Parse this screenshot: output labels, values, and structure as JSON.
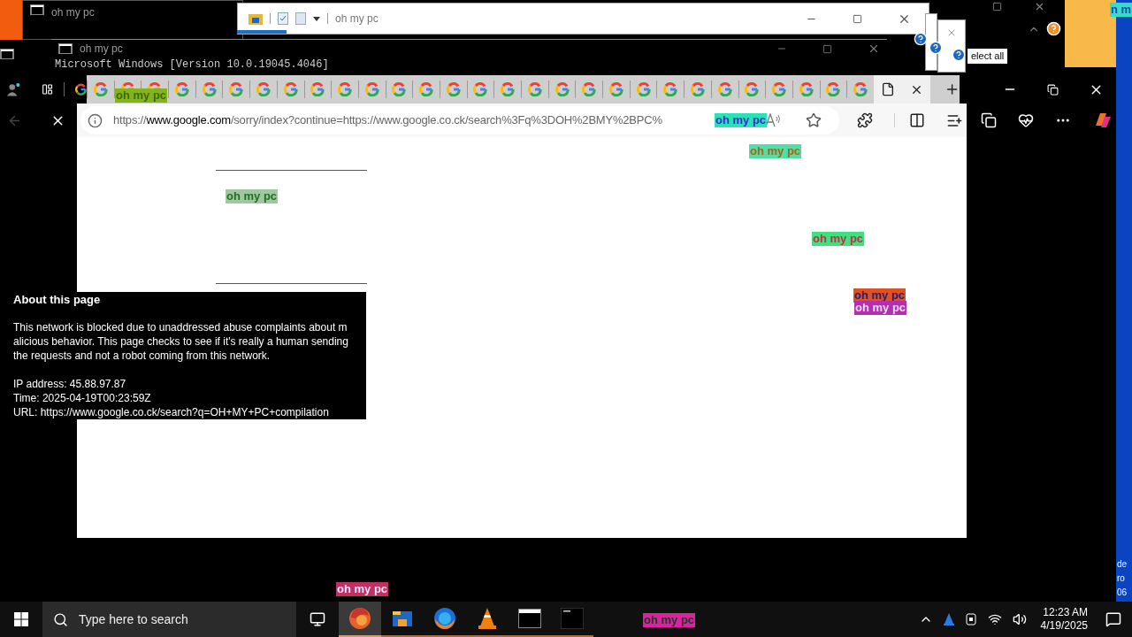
{
  "console_windows": [
    {
      "title": "oh my pc"
    },
    {
      "title": "oh my pc"
    }
  ],
  "console_text": "Microsoft Windows [Version 10.0.19045.4046]",
  "explorer_window": {
    "title": "oh my pc"
  },
  "dialog_text": "elect all",
  "browser": {
    "tabs": [
      {
        "selected": false
      },
      {
        "selected": false
      },
      {
        "selected": false
      },
      {
        "selected": false
      },
      {
        "selected": false
      },
      {
        "selected": false
      },
      {
        "selected": false
      },
      {
        "selected": false
      },
      {
        "selected": false
      },
      {
        "selected": false
      },
      {
        "selected": false
      },
      {
        "selected": false
      },
      {
        "selected": false
      },
      {
        "selected": false
      },
      {
        "selected": false
      },
      {
        "selected": false
      },
      {
        "selected": false
      },
      {
        "selected": false
      },
      {
        "selected": false
      },
      {
        "selected": false
      },
      {
        "selected": false
      },
      {
        "selected": false
      },
      {
        "selected": false
      },
      {
        "selected": false
      },
      {
        "selected": false
      },
      {
        "selected": false
      },
      {
        "selected": false
      },
      {
        "selected": false
      },
      {
        "selected": false
      },
      {
        "selected": true
      }
    ],
    "url_prefix": "https://",
    "url_host": "www.google.com",
    "url_rest": "/sorry/index?continue=https://www.google.co.ck/search%3Fq%3DOH%2BMY%2BPC%"
  },
  "about_box": {
    "heading": "About this page",
    "paragraph": "This network is blocked due to unaddressed abuse complaints about malicious behavior. This page checks to see if it's really a human sending the requests and not a robot coming from this network.",
    "lines": [
      "IP address: 45.88.97.87",
      "Time: 2025-04-19T00:23:59Z",
      "URL: https://www.google.co.ck/search?q=OH+MY+PC+compilation"
    ]
  },
  "popups": [
    {
      "text": "oh my pc",
      "color": "#84b31c"
    },
    {
      "text": "oh my pc",
      "color": "#27e3b8"
    },
    {
      "text": "oh my pc",
      "color": "#a0c8a0"
    },
    {
      "text": "oh my pc",
      "color": "#4de0a8"
    },
    {
      "text": "oh my pc",
      "color": "#40e080"
    },
    {
      "text": "oh my pc",
      "color": "#e05020"
    },
    {
      "text": "oh my pc",
      "color": "#b030b0"
    },
    {
      "text": "oh my pc",
      "color": "#c03060"
    },
    {
      "text": "oh my pc",
      "color": "#e020a0"
    },
    {
      "text": "n m",
      "color": "#30e0c0"
    }
  ],
  "edge_text": [
    "de",
    "ro",
    "06"
  ],
  "taskbar": {
    "search_placeholder": "Type here to search",
    "apps": [
      {
        "kind": "edge",
        "selected": true
      },
      {
        "kind": "explorer",
        "selected": false
      },
      {
        "kind": "firefox",
        "selected": false
      },
      {
        "kind": "vlc",
        "selected": false
      },
      {
        "kind": "cmd",
        "selected": false
      },
      {
        "kind": "terminal",
        "selected": false
      }
    ],
    "time": "12:23 AM",
    "date": "4/19/2025"
  }
}
